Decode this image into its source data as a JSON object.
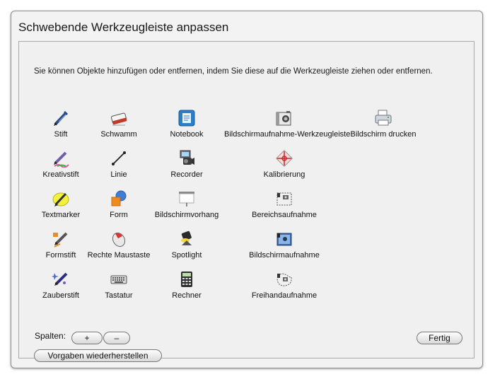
{
  "window": {
    "title": "Schwebende Werkzeugleiste anpassen"
  },
  "instructions": "Sie können Objekte hinzufügen oder entfernen, indem Sie diese auf die Werkzeugleiste ziehen oder entfernen.",
  "tools": {
    "stift": "Stift",
    "schwamm": "Schwamm",
    "notebook": "Notebook",
    "bildschirmaufnahme_werkzeugleiste": "Bildschirmaufnahme-Werkzeugleiste",
    "bildschirm_drucken": "Bildschirm drucken",
    "kreativstift": "Kreativstift",
    "linie": "Linie",
    "recorder": "Recorder",
    "kalibrierung": "Kalibrierung",
    "textmarker": "Textmarker",
    "form": "Form",
    "bildschirmvorhang": "Bildschirmvorhang",
    "bereichsaufnahme": "Bereichsaufnahme",
    "formstift": "Formstift",
    "rechte_maustaste": "Rechte Maustaste",
    "spotlight": "Spotlight",
    "bildschirmaufnahme": "Bildschirmaufnahme",
    "zauberstift": "Zauberstift",
    "tastatur": "Tastatur",
    "rechner": "Rechner",
    "freihandaufnahme": "Freihandaufnahme"
  },
  "columns": {
    "label": "Spalten:",
    "plus": "+",
    "minus": "–"
  },
  "buttons": {
    "restore_defaults": "Vorgaben wiederherstellen",
    "done": "Fertig"
  }
}
